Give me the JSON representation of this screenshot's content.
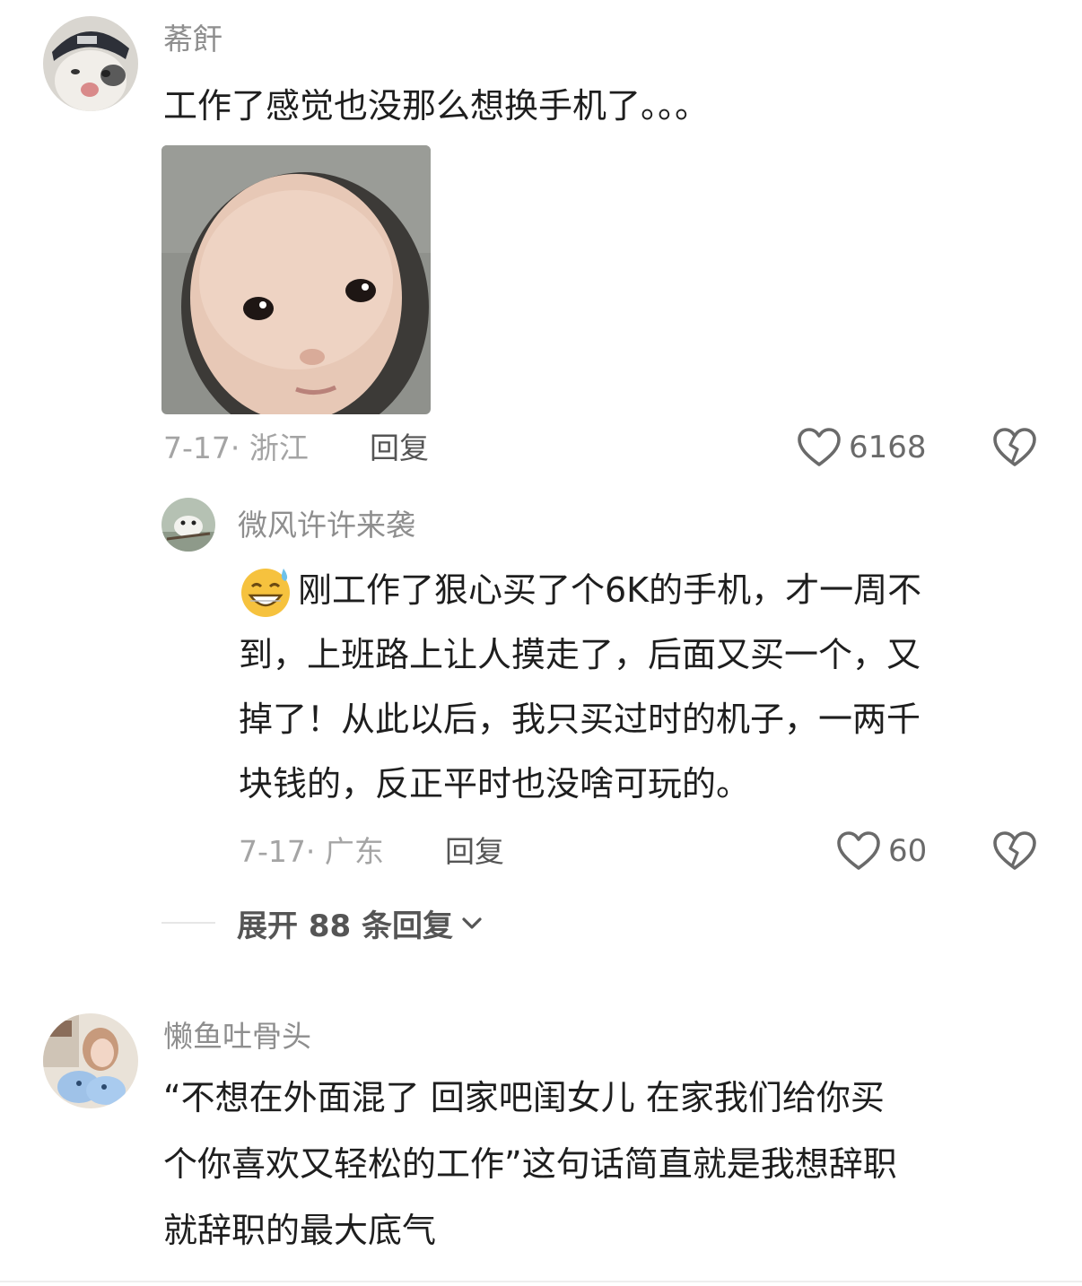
{
  "comments": [
    {
      "username": "莃飦",
      "text": "工作了感觉也没那么想换手机了。。。",
      "meta": "7-17· 浙江",
      "reply_label": "回复",
      "likes": "6168",
      "avatar_icon": "cat-with-cap-avatar",
      "image_icon": "baby-face-image"
    },
    {
      "username": "懒鱼吐骨头",
      "text_lines": [
        "“不想在外面混了 回家吧闺女儿  在家我们给你买",
        "个你喜欢又轻松的工作”这句话简直就是我想辞职",
        "就辞职的最大底气"
      ],
      "avatar_icon": "girl-photo-avatar"
    }
  ],
  "reply": {
    "username": "微风许许来袭",
    "text_lines": [
      "刚工作了狠心买了个6K的手机，才一周不",
      "到，上班路上让人摸走了，后面又买一个，又",
      "掉了！从此以后，我只买过时的机子，一两千",
      "块钱的，反正平时也没啥可玩的。"
    ],
    "emoji_icon": "grinning-sweat-emoji",
    "meta": "7-17· 广东",
    "reply_label": "回复",
    "likes": "60",
    "avatar_icon": "bird-photo-avatar"
  },
  "expand_replies": {
    "label": "展开 88 条回复",
    "icon": "chevron-down-icon"
  },
  "colors": {
    "username": "#8e8e8e",
    "text": "#1e1e1e",
    "meta": "#a4a4a4",
    "icon": "#6a6a6a"
  }
}
